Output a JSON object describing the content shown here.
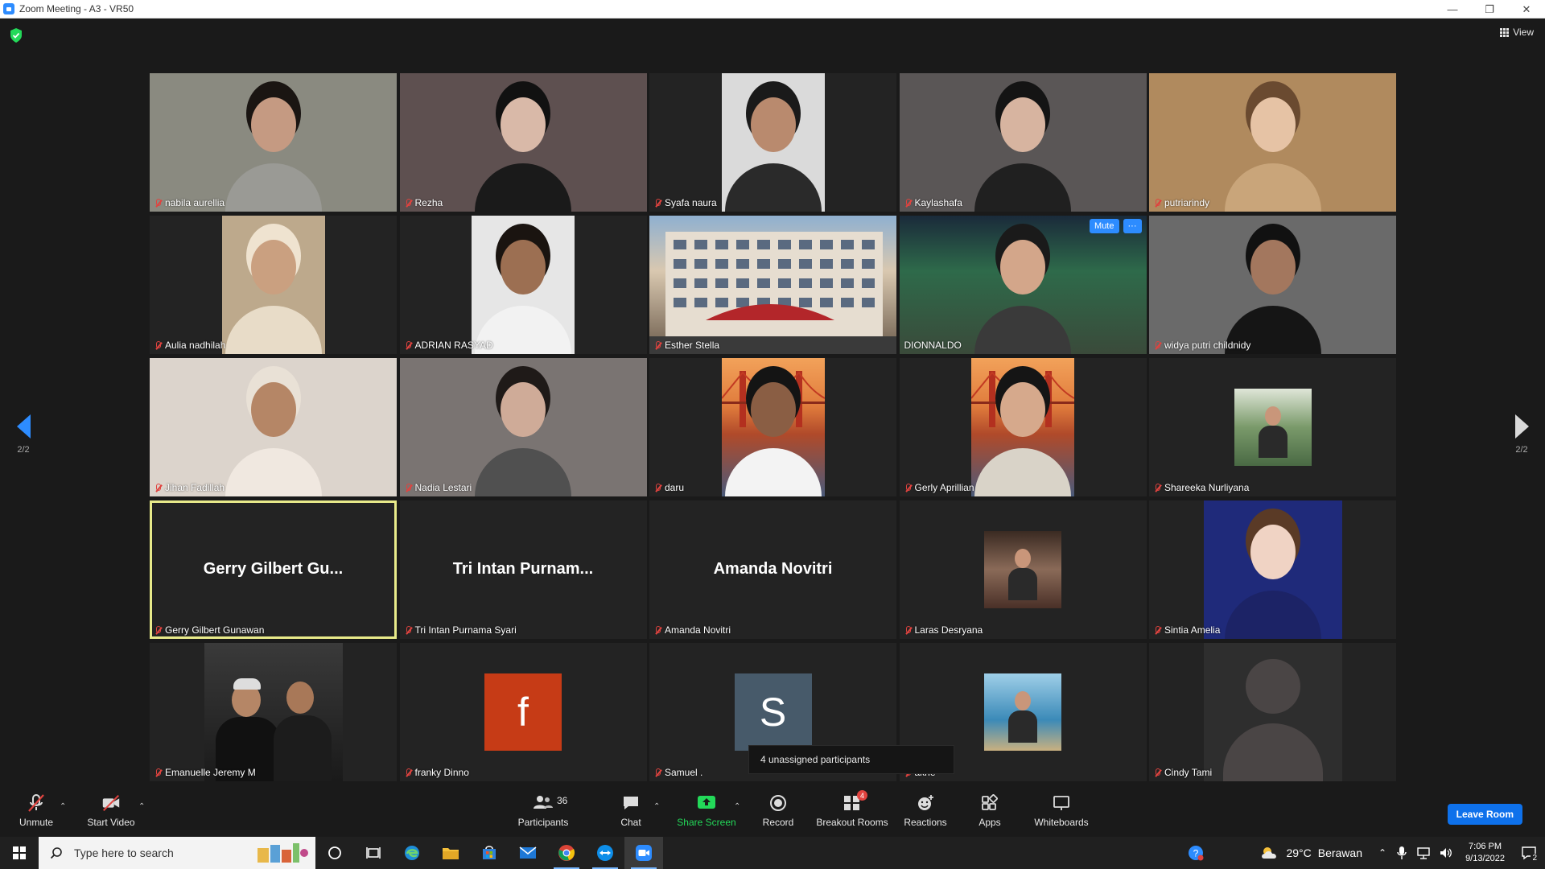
{
  "window": {
    "title": "Zoom Meeting - A3 - VR50"
  },
  "view": {
    "label": "View"
  },
  "pager": {
    "left": "2/2",
    "right": "2/2"
  },
  "participants": [
    {
      "name": "nabila aurellia",
      "type": "video",
      "bg": "#8a8a80",
      "skin": "#c59a82",
      "hair": "#1a1512",
      "shirt": "#9a9a95",
      "width": "full"
    },
    {
      "name": "Rezha",
      "type": "video",
      "bg": "#5e5050",
      "skin": "#d9b9a8",
      "hair": "#111111",
      "shirt": "#1a1a1a",
      "width": "full"
    },
    {
      "name": "Syafa naura",
      "type": "video",
      "bg": "#dadada",
      "skin": "#b98a6e",
      "hair": "#1a1a1a",
      "shirt": "#2a2a2a",
      "width": "narrow"
    },
    {
      "name": "Kaylashafa",
      "type": "video",
      "bg": "#5a5656",
      "skin": "#d7b4a0",
      "hair": "#141414",
      "shirt": "#202020",
      "width": "full"
    },
    {
      "name": "putriarindy",
      "type": "video",
      "bg": "#b08a5e",
      "skin": "#e6c3a5",
      "hair": "#6a4a30",
      "shirt": "#c9a57a",
      "width": "full"
    },
    {
      "name": "Aulia nadhilah",
      "type": "video",
      "bg": "#bda98c",
      "skin": "#caa080",
      "hair": "#efe3d0",
      "shirt": "#e8dcc8",
      "width": "narrow"
    },
    {
      "name": "ADRIAN RASYAD",
      "type": "video",
      "bg": "#e6e6e6",
      "skin": "#9c6f52",
      "hair": "#1a1410",
      "shirt": "#f2f2f2",
      "width": "narrow"
    },
    {
      "name": "Esther Stella",
      "type": "scene",
      "bg": "#c9b7a0",
      "accent": "#b3262a",
      "width": "full"
    },
    {
      "name": "DIONNALDO",
      "type": "video",
      "bg": "#2e5a47",
      "skin": "#d3a68a",
      "hair": "#1a1a1a",
      "shirt": "#3a3a3a",
      "width": "full",
      "controls": {
        "mute": "Mute",
        "more": "···"
      }
    },
    {
      "name": "widya putri childnidy",
      "type": "video",
      "bg": "#6a6a6a",
      "skin": "#a3775e",
      "hair": "#111111",
      "shirt": "#151515",
      "width": "full"
    },
    {
      "name": "Jihan Fadillah",
      "type": "video",
      "bg": "#dcd4cc",
      "skin": "#b58666",
      "hair": "#e9e1d6",
      "shirt": "#f0e8e0",
      "width": "full"
    },
    {
      "name": "Nadia Lestari",
      "type": "video",
      "bg": "#7a7472",
      "skin": "#cfab98",
      "hair": "#1f1a18",
      "shirt": "#505050",
      "width": "full"
    },
    {
      "name": "daru",
      "type": "bridge",
      "bg": "#e48b4e",
      "skin": "#8a5e44",
      "hair": "#141414",
      "shirt": "#f3f3f3",
      "width": "narrow"
    },
    {
      "name": "Gerly Aprillian",
      "type": "bridge",
      "bg": "#d9884e",
      "skin": "#d6a98c",
      "hair": "#151515",
      "shirt": "#d9d3c8",
      "width": "narrow"
    },
    {
      "name": "Shareeka Nurliyana",
      "type": "thumb",
      "bg": "#6d8a66",
      "width": "thumb"
    },
    {
      "name": "Gerry Gilbert Gunawan",
      "type": "name",
      "display": "Gerry Gilbert Gu...",
      "active": true
    },
    {
      "name": "Tri Intan Purnama Syari",
      "type": "name",
      "display": "Tri Intan Purnam..."
    },
    {
      "name": "Amanda Novitri",
      "type": "name",
      "display": "Amanda Novitri"
    },
    {
      "name": "Laras Desryana",
      "type": "thumb",
      "bg": "#6e5244",
      "width": "thumb"
    },
    {
      "name": "Sintia Amelia",
      "type": "video",
      "bg": "#1f2a7a",
      "skin": "#f0d3c4",
      "hair": "#5a3a26",
      "shirt": "#1c2366",
      "width": "mid"
    },
    {
      "name": "Emanuelle Jeremy M",
      "type": "group",
      "bg": "#2a2a2a",
      "width": "mid"
    },
    {
      "name": "franky Dinno",
      "type": "letter",
      "letter": "f",
      "bg": "#c63b16"
    },
    {
      "name": "Samuel .",
      "type": "letter",
      "letter": "S",
      "bg": "#475a6a"
    },
    {
      "name": "Deni Bakrie",
      "namevisible": "akrie",
      "type": "thumb",
      "bg": "#3b8ab8",
      "width": "thumb"
    },
    {
      "name": "Cindy Tami",
      "type": "silhouette",
      "bg": "#2e2e2e"
    }
  ],
  "tooltip": {
    "text": "4 unassigned participants"
  },
  "toolbar": {
    "unmute": "Unmute",
    "start_video": "Start Video",
    "participants": "Participants",
    "participants_count": "36",
    "chat": "Chat",
    "share_screen": "Share Screen",
    "record": "Record",
    "breakout_rooms": "Breakout Rooms",
    "breakout_badge": "4",
    "reactions": "Reactions",
    "apps": "Apps",
    "whiteboards": "Whiteboards",
    "leave": "Leave Room"
  },
  "taskbar": {
    "search_placeholder": "Type here to search",
    "weather_temp": "29°C",
    "weather_text": "Berawan",
    "time": "7:06 PM",
    "date": "9/13/2022",
    "notification_count": "2"
  },
  "colors": {
    "accent": "#2d8cff",
    "active_speaker": "#e8ea8a",
    "muted_red": "#e0433f",
    "share_green": "#23d959",
    "leave_blue": "#0e71eb"
  }
}
